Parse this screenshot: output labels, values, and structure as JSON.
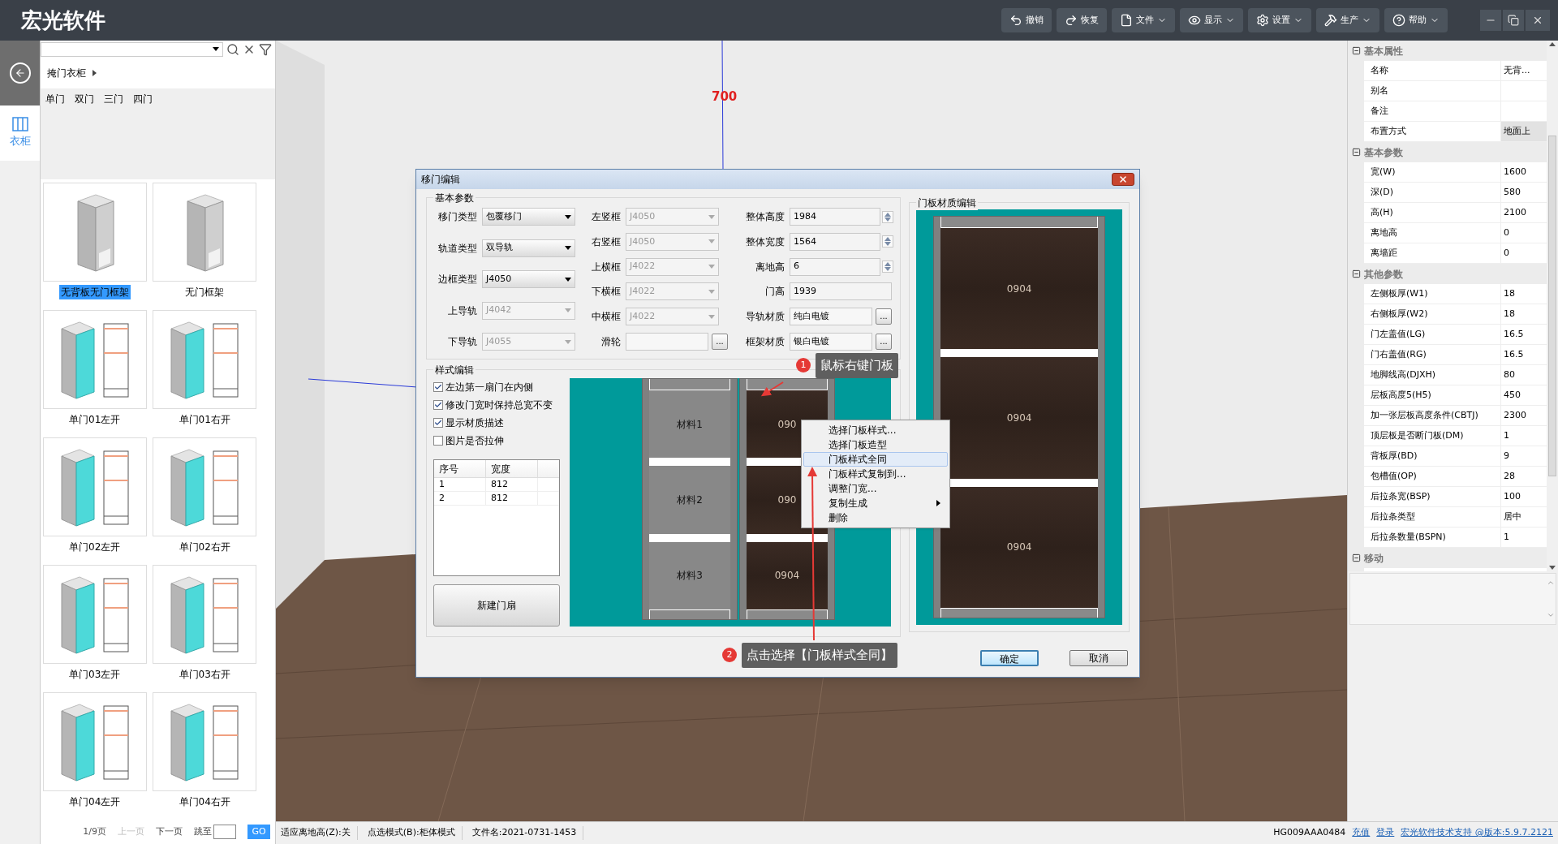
{
  "app": {
    "logo": "宏光软件"
  },
  "toolbar": [
    {
      "label": "撤销",
      "kind": "undo",
      "menu": false
    },
    {
      "label": "恢复",
      "kind": "redo",
      "menu": false
    },
    {
      "label": "文件",
      "kind": "file",
      "menu": true
    },
    {
      "label": "显示",
      "kind": "display",
      "menu": true
    },
    {
      "label": "设置",
      "kind": "settings",
      "menu": true
    },
    {
      "label": "生产",
      "kind": "production",
      "menu": true
    },
    {
      "label": "帮助",
      "kind": "help",
      "menu": true
    }
  ],
  "sidebar_tabs": [
    {
      "label": "衣柜",
      "selected": true
    }
  ],
  "library": {
    "breadcrumb": "掩门衣柜",
    "categories": [
      "单门",
      "双门",
      "三门",
      "四门"
    ],
    "items": [
      {
        "label": "无背板无门框架",
        "kind": "frame",
        "selected": true
      },
      {
        "label": "无门框架",
        "kind": "frame",
        "selected": false
      },
      {
        "label": "单门01左开",
        "kind": "door",
        "selected": false
      },
      {
        "label": "单门01右开",
        "kind": "door",
        "selected": false
      },
      {
        "label": "单门02左开",
        "kind": "door",
        "selected": false
      },
      {
        "label": "单门02右开",
        "kind": "door",
        "selected": false
      },
      {
        "label": "单门03左开",
        "kind": "door",
        "selected": false
      },
      {
        "label": "单门03右开",
        "kind": "door",
        "selected": false
      },
      {
        "label": "单门04左开",
        "kind": "door",
        "selected": false
      },
      {
        "label": "单门04右开",
        "kind": "door",
        "selected": false
      }
    ],
    "pagination": {
      "page": "1/9页",
      "prev": {
        "label": "上一页",
        "disabled": true
      },
      "next": {
        "label": "下一页",
        "disabled": false
      },
      "jump": "跳至",
      "go": "GO"
    }
  },
  "viewport": {
    "dimension": "700"
  },
  "dialog": {
    "title": "移门编辑",
    "basic": {
      "title": "基本参数",
      "columns": [
        [
          {
            "label": "移门类型",
            "kind": "dropdown",
            "value": "包覆移门",
            "disabled": false
          },
          {
            "label": "轨道类型",
            "kind": "dropdown",
            "value": "双导轨",
            "disabled": false
          },
          {
            "label": "边框类型",
            "kind": "dropdown",
            "value": "J4050",
            "disabled": false
          },
          {
            "label": "上导轨",
            "kind": "dropdown",
            "value": "J4042",
            "disabled": true
          },
          {
            "label": "下导轨",
            "kind": "dropdown",
            "value": "J4055",
            "disabled": true
          }
        ],
        [
          {
            "label": "左竖框",
            "kind": "dropdown",
            "value": "J4050",
            "disabled": true
          },
          {
            "label": "右竖框",
            "kind": "dropdown",
            "value": "J4050",
            "disabled": true
          },
          {
            "label": "上横框",
            "kind": "dropdown",
            "value": "J4022",
            "disabled": true
          },
          {
            "label": "下横框",
            "kind": "dropdown",
            "value": "J4022",
            "disabled": true
          },
          {
            "label": "中横框",
            "kind": "dropdown",
            "value": "J4022",
            "disabled": true
          },
          {
            "label": "滑轮",
            "kind": "browse",
            "button": "...",
            "disabled": false
          }
        ],
        [
          {
            "label": "整体高度",
            "kind": "spin",
            "value": "1984",
            "disabled": false
          },
          {
            "label": "整体宽度",
            "kind": "spin",
            "value": "1564",
            "disabled": false
          },
          {
            "label": "离地高",
            "kind": "spin",
            "value": "6",
            "disabled": false
          },
          {
            "label": "门高",
            "kind": "text",
            "value": "1939",
            "disabled": false
          },
          {
            "label": "导轨材质",
            "kind": "browse",
            "value": "纯白电镀",
            "button": "...",
            "disabled": false
          },
          {
            "label": "框架材质",
            "kind": "browse",
            "value": "银白电镀",
            "button": "...",
            "disabled": false
          }
        ]
      ]
    },
    "style": {
      "title": "样式编辑",
      "options": [
        {
          "label": "左边第一扇门在内侧",
          "checked": true
        },
        {
          "label": "修改门宽时保持总宽不变",
          "checked": true
        },
        {
          "label": "显示材质描述",
          "checked": true
        },
        {
          "label": "图片是否拉伸",
          "checked": false
        }
      ],
      "table": {
        "columns": [
          "序号",
          "宽度"
        ],
        "rows": [
          [
            "1",
            "812"
          ],
          [
            "2",
            "812"
          ]
        ]
      },
      "new_button": "新建门扇",
      "doors": [
        {
          "kind": "plain",
          "labels": [
            "材料1",
            "材料2",
            "材料3"
          ]
        },
        {
          "kind": "wood",
          "labels": [
            "090",
            "090",
            "0904"
          ]
        }
      ]
    },
    "material": {
      "title": "门板材质编辑",
      "kind": "wood",
      "labels": [
        "0904",
        "0904",
        "0904"
      ]
    },
    "context_menu": [
      {
        "label": "选择门板样式...",
        "selected": false,
        "submenu": false
      },
      {
        "label": "选择门板造型",
        "selected": false,
        "submenu": false
      },
      {
        "label": "门板样式全同",
        "selected": true,
        "submenu": false
      },
      {
        "label": "门板样式复制到...",
        "selected": false,
        "submenu": false
      },
      {
        "label": "调整门宽...",
        "selected": false,
        "submenu": false
      },
      {
        "label": "复制生成",
        "selected": false,
        "submenu": true
      },
      {
        "label": "删除",
        "selected": false,
        "submenu": false
      }
    ],
    "callouts": [
      {
        "number": "1",
        "text": "鼠标右键门板"
      },
      {
        "number": "2",
        "text": "点击选择【门板样式全同】"
      }
    ],
    "buttons": [
      {
        "label": "确定",
        "default": true
      },
      {
        "label": "取消",
        "default": false
      }
    ]
  },
  "properties": [
    {
      "title": "基本属性",
      "expanded": true,
      "rows": [
        {
          "name": "名称",
          "value": "无背...",
          "selected": false
        },
        {
          "name": "别名",
          "selected": false
        },
        {
          "name": "备注",
          "selected": false
        },
        {
          "name": "布置方式",
          "value": "地面上",
          "selected": true
        }
      ]
    },
    {
      "title": "基本参数",
      "expanded": true,
      "rows": [
        {
          "name": "宽(W)",
          "value": "1600",
          "selected": false
        },
        {
          "name": "深(D)",
          "value": "580",
          "selected": false
        },
        {
          "name": "高(H)",
          "value": "2100",
          "selected": false
        },
        {
          "name": "离地高",
          "value": "0",
          "selected": false
        },
        {
          "name": "离墙距",
          "value": "0",
          "selected": false
        }
      ]
    },
    {
      "title": "其他参数",
      "expanded": true,
      "rows": [
        {
          "name": "左侧板厚(W1)",
          "value": "18",
          "selected": false
        },
        {
          "name": "右侧板厚(W2)",
          "value": "18",
          "selected": false
        },
        {
          "name": "门左盖值(LG)",
          "value": "16.5",
          "selected": false
        },
        {
          "name": "门右盖值(RG)",
          "value": "16.5",
          "selected": false
        },
        {
          "name": "地脚线高(DJXH)",
          "value": "80",
          "selected": false
        },
        {
          "name": "层板高度5(H5)",
          "value": "450",
          "selected": false
        },
        {
          "name": "加一张层板高度条件(CBTJ)",
          "value": "2300",
          "selected": false
        },
        {
          "name": "顶层板是否断门板(DM)",
          "value": "1",
          "selected": false
        },
        {
          "name": "背板厚(BD)",
          "value": "9",
          "selected": false
        },
        {
          "name": "包槽值(OP)",
          "value": "28",
          "selected": false
        },
        {
          "name": "后拉条宽(BSP)",
          "value": "100",
          "selected": false
        },
        {
          "name": "后拉条类型",
          "value": "居中",
          "selected": false
        },
        {
          "name": "后拉条数量(BSPN)",
          "value": "1",
          "selected": false
        }
      ]
    },
    {
      "title": "移动",
      "expanded": true
    }
  ],
  "status_bar": {
    "items": [
      "适应离地高(Z):关",
      "点选模式(B):柜体模式",
      "文件名:2021-0731-1453"
    ],
    "code": "HG009AAA0484",
    "links": [
      "充值",
      "登录",
      "宏光软件技术支持 @版本:5.9.7.2121"
    ]
  }
}
